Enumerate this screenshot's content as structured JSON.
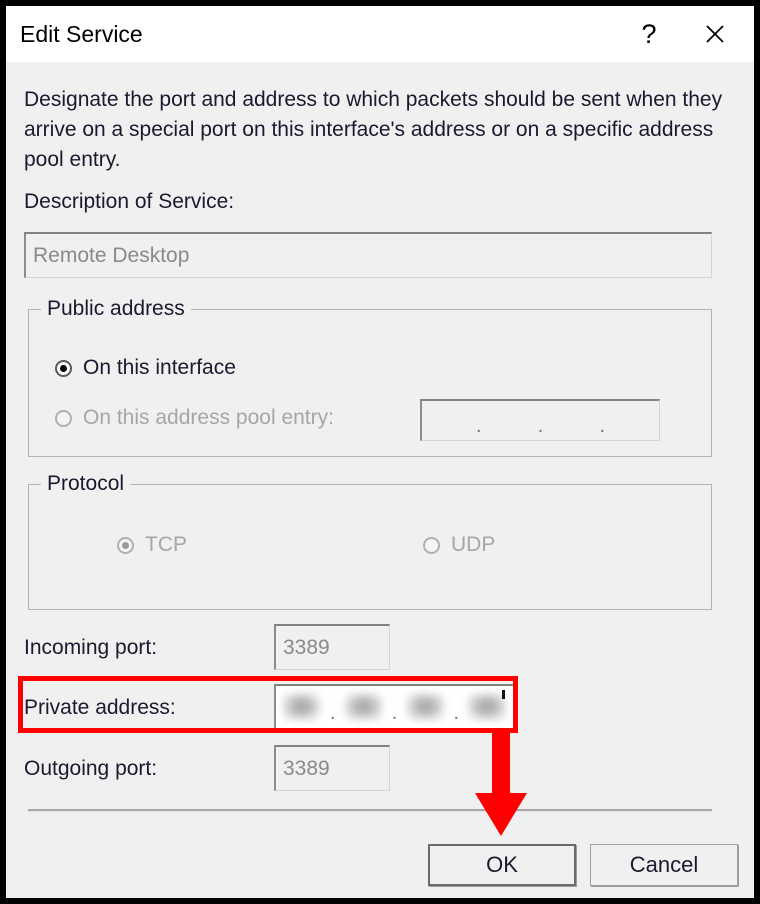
{
  "window": {
    "title": "Edit Service",
    "help_icon": "question-mark-icon",
    "close_icon": "close-icon",
    "accent_annotation_color": "#fe0000",
    "background_color": "#f0f0f0"
  },
  "description": "Designate the port and address to which packets should be sent when they arrive on a special port on this interface's address or on a specific address pool entry.",
  "description_field": {
    "label": "Description of Service:",
    "value": "Remote Desktop",
    "enabled": false
  },
  "public_address": {
    "legend": "Public address",
    "options": [
      {
        "label": "On this interface",
        "selected": true,
        "enabled": true
      },
      {
        "label": "On this address pool entry:",
        "selected": false,
        "enabled": false
      }
    ],
    "pool_entry_ip": {
      "octets": [
        "",
        "",
        "",
        ""
      ],
      "separator": ".",
      "enabled": false
    }
  },
  "protocol": {
    "legend": "Protocol",
    "options": [
      {
        "label": "TCP",
        "selected": true,
        "enabled": false
      },
      {
        "label": "UDP",
        "selected": false,
        "enabled": false
      }
    ]
  },
  "ports": {
    "incoming": {
      "label": "Incoming port:",
      "value": "3389",
      "enabled": false
    },
    "outgoing": {
      "label": "Outgoing port:",
      "value": "3389",
      "enabled": false
    }
  },
  "private_address": {
    "label": "Private address:",
    "separator": ".",
    "octets": [
      "",
      "",
      "",
      ""
    ],
    "redacted": true,
    "highlighted": true
  },
  "buttons": {
    "ok": "OK",
    "cancel": "Cancel"
  }
}
